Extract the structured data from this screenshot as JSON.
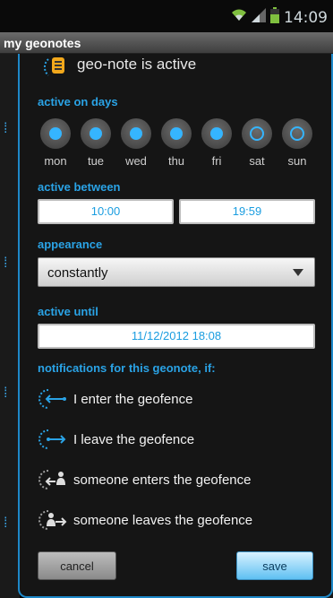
{
  "status_bar": {
    "time": "14:09"
  },
  "app": {
    "title": "my geonotes"
  },
  "dialog": {
    "active_label": "geo-note is active",
    "days_section": "active on days",
    "days": [
      {
        "name": "mon",
        "checked": true
      },
      {
        "name": "tue",
        "checked": true
      },
      {
        "name": "wed",
        "checked": true
      },
      {
        "name": "thu",
        "checked": true
      },
      {
        "name": "fri",
        "checked": true
      },
      {
        "name": "sat",
        "checked": false
      },
      {
        "name": "sun",
        "checked": false
      }
    ],
    "between_section": "active between",
    "start_time": "10:00",
    "end_time": "19:59",
    "appearance_section": "appearance",
    "appearance_value": "constantly",
    "until_section": "active until",
    "until_value": "11/12/2012 18:08",
    "notifications_section": "notifications for this geonote, if:",
    "notifications": [
      {
        "label": "I enter the geofence",
        "icon": "enter-geofence-icon"
      },
      {
        "label": "I leave the geofence",
        "icon": "leave-geofence-icon"
      },
      {
        "label": "someone enters the geofence",
        "icon": "someone-enters-icon"
      },
      {
        "label": "someone leaves the geofence",
        "icon": "someone-leaves-icon"
      }
    ],
    "cancel_label": "cancel",
    "save_label": "save"
  },
  "colors": {
    "accent": "#2aa3e6",
    "border": "#1e88c8",
    "background": "#151515"
  }
}
